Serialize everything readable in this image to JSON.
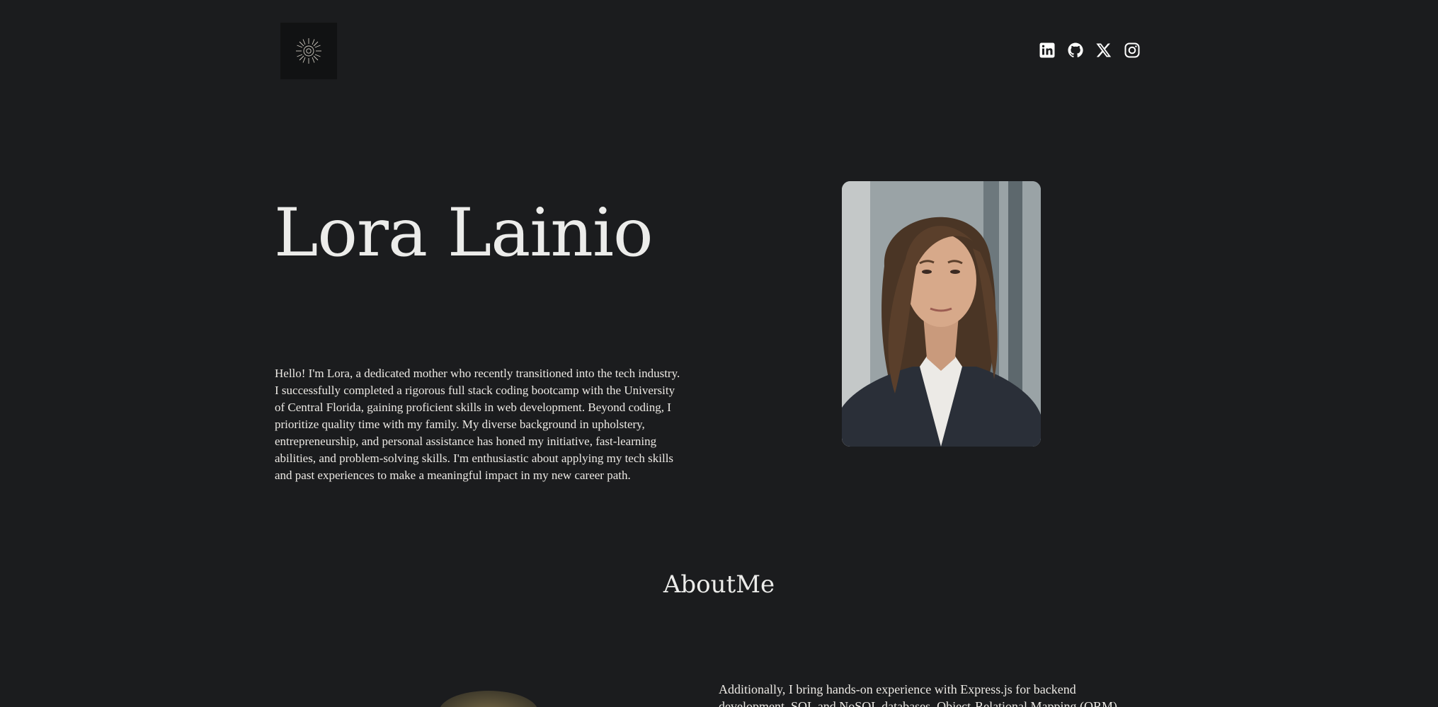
{
  "header": {
    "logo_icon": "sun-emblem-icon",
    "social": [
      {
        "name": "linkedin",
        "icon": "linkedin-icon"
      },
      {
        "name": "github",
        "icon": "github-icon"
      },
      {
        "name": "x",
        "icon": "x-icon"
      },
      {
        "name": "instagram",
        "icon": "instagram-icon"
      }
    ]
  },
  "hero": {
    "name": "Lora Lainio",
    "bio": "Hello! I'm Lora, a dedicated mother who recently transitioned into the tech industry. I successfully completed a rigorous full stack coding bootcamp with the University of Central Florida, gaining proficient skills in web development. Beyond coding, I prioritize quality time with my family. My diverse background in upholstery, entrepreneurship, and personal assistance has honed my initiative, fast-learning abilities, and problem-solving skills. I'm enthusiastic about applying my tech skills and past experiences to make a meaningful impact in my new career path."
  },
  "about": {
    "title": "AboutMe",
    "text": "Additionally, I bring hands-on experience with Express.js for backend development, SQL and NoSQL databases, Object-Relational Mapping (ORM)"
  },
  "colors": {
    "background": "#1b1c1e",
    "text": "#ececea",
    "logo_bg": "#111213"
  }
}
